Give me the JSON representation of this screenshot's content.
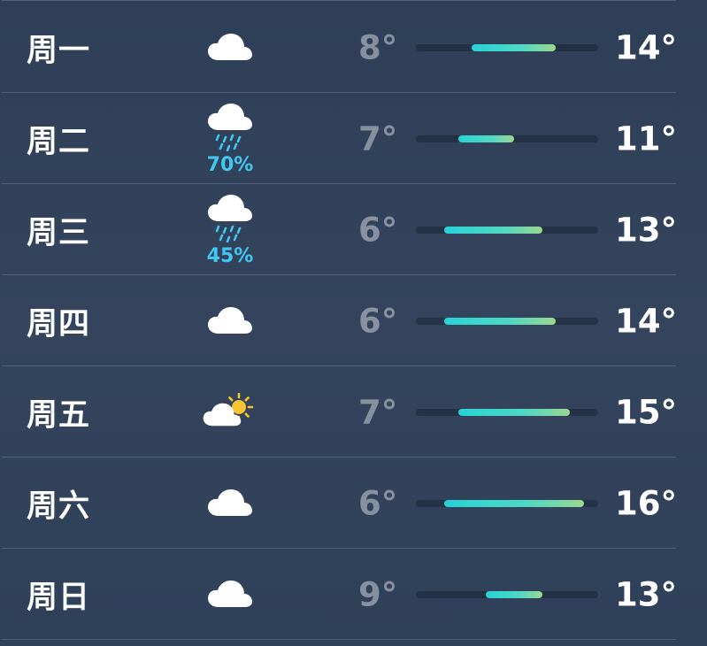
{
  "forecast": {
    "days": [
      {
        "day": "周一",
        "icon": "cloud-icon",
        "precip": "",
        "low": "8°",
        "high": "14°",
        "range": {
          "start": 8,
          "end": 14
        }
      },
      {
        "day": "周二",
        "icon": "cloud-rain-icon",
        "precip": "70%",
        "low": "7°",
        "high": "11°",
        "range": {
          "start": 7,
          "end": 11
        }
      },
      {
        "day": "周三",
        "icon": "cloud-rain-icon",
        "precip": "45%",
        "low": "6°",
        "high": "13°",
        "range": {
          "start": 6,
          "end": 13
        }
      },
      {
        "day": "周四",
        "icon": "cloud-icon",
        "precip": "",
        "low": "6°",
        "high": "14°",
        "range": {
          "start": 6,
          "end": 14
        }
      },
      {
        "day": "周五",
        "icon": "cloud-sun-icon",
        "precip": "",
        "low": "7°",
        "high": "15°",
        "range": {
          "start": 7,
          "end": 15
        }
      },
      {
        "day": "周六",
        "icon": "cloud-icon",
        "precip": "",
        "low": "6°",
        "high": "16°",
        "range": {
          "start": 6,
          "end": 16
        }
      },
      {
        "day": "周日",
        "icon": "cloud-icon",
        "precip": "",
        "low": "9°",
        "high": "13°",
        "range": {
          "start": 9,
          "end": 13
        }
      }
    ]
  },
  "colors": {
    "background": "#2f4058",
    "precip_text": "#40c7f2",
    "bar_start": "#28d2d8",
    "bar_end": "#9ad88e",
    "sun": "#f6c531"
  }
}
